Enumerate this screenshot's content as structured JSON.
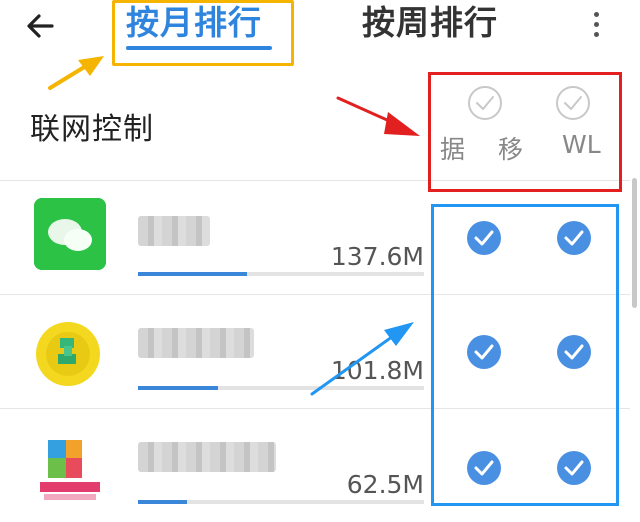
{
  "header": {
    "back_icon": "arrow-left-icon",
    "tabs": [
      {
        "label": "按月排行",
        "active": true
      },
      {
        "label": "按周排行",
        "active": false
      }
    ],
    "more_icon": "more-vertical-icon"
  },
  "section": {
    "title": "联网控制",
    "columns": [
      {
        "label": "据",
        "checked": false
      },
      {
        "label": "移",
        "checked": false
      },
      {
        "label": "WL",
        "checked": false
      }
    ]
  },
  "apps": [
    {
      "icon": "wechat-app-icon",
      "name": "",
      "size": "137.6M",
      "usage_fraction": 0.38,
      "mobile_data": true,
      "wlan": true
    },
    {
      "icon": "qq-music-app-icon",
      "name": "",
      "size": "101.8M",
      "usage_fraction": 0.28,
      "mobile_data": true,
      "wlan": true
    },
    {
      "icon": "browser-app-icon",
      "name": "",
      "size": "62.5M",
      "usage_fraction": 0.17,
      "mobile_data": true,
      "wlan": true
    }
  ],
  "colors": {
    "accent": "#2f85de",
    "check_fill": "#4a90e2",
    "annotation_yellow": "#f5b400",
    "annotation_red": "#e32020",
    "annotation_blue": "#2196f3"
  }
}
